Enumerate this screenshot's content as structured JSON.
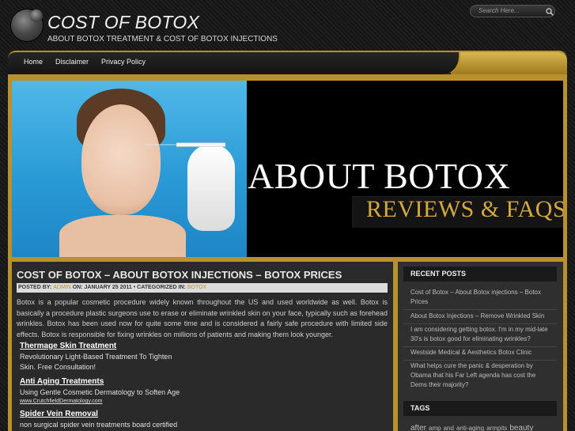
{
  "header": {
    "title": "COST OF BOTOX",
    "tagline": "ABOUT BOTOX TREATMENT & COST OF BOTOX INJECTIONS"
  },
  "nav": {
    "items": [
      {
        "label": "Home"
      },
      {
        "label": "Disclaimer"
      },
      {
        "label": "Privacy Policy"
      }
    ],
    "search_placeholder": "Search Here..."
  },
  "banner": {
    "title": "ABOUT BOTOX",
    "subtitle": "REVIEWS & FAQS"
  },
  "post": {
    "title": "COST OF BOTOX – ABOUT BOTOX INJECTIONS – BOTOX PRICES",
    "meta": {
      "posted_by_label": "POSTED BY:",
      "author": "ADMIN",
      "on_label": "ON: JANUARY 25 2011 • CATEGORIZED IN:",
      "category": "BOTOX"
    },
    "body": "Botox is a popular cosmetic procedure widely known throughout the US and used worldwide as well. Botox is basically a procedure plastic surgeons use to erase or eliminate wrinkled skin on your face, typically such as forehead wrinkles. Botox has been used now for quite some time and is considered a fairly safe procedure with limited side effects. Botox is responsible for fixing wrinkles on millions of patients and making them look younger."
  },
  "ads": [
    {
      "title": "Thermage Skin Treatment",
      "line1": "Revolutionary Light-Based Treatment To Tighten",
      "line2": "Skin. Free Consultation!"
    },
    {
      "title": "Anti Aging Treatments",
      "line1": "Using Gentle Cosmetic Dermatology to Soften Age",
      "url": "www.CrutchfieldDermatology.com"
    },
    {
      "title": "Spider Vein Removal",
      "line1": "non surgical spider vein treatments board certified"
    }
  ],
  "sidebar": {
    "recent_posts_title": "RECENT POSTS",
    "recent_posts": [
      {
        "label": "Cost of Botox – About Botox injections – Botox Prices"
      },
      {
        "label": "About Botox Injections – Remove Wrinkled Skin"
      },
      {
        "label": "I am considering getting botox. I'm in my mid-late 30's is botox good for eliminating wrinkles?"
      },
      {
        "label": "Westside Medical & Aesthetics Botox Clinic"
      },
      {
        "label": "What helps cure the panic & desperation by Obama that his Far Left agenda has cost the Dems their majority?"
      }
    ],
    "tags_title": "TAGS",
    "tags": [
      {
        "label": "after"
      },
      {
        "label": "amp"
      },
      {
        "label": "and"
      },
      {
        "label": "anti-aging"
      },
      {
        "label": "armpits"
      },
      {
        "label": "beauty"
      }
    ]
  },
  "colors": {
    "gold": "#b8912c",
    "background": "#1b1b1b",
    "banner_sub": "#d4a942"
  }
}
